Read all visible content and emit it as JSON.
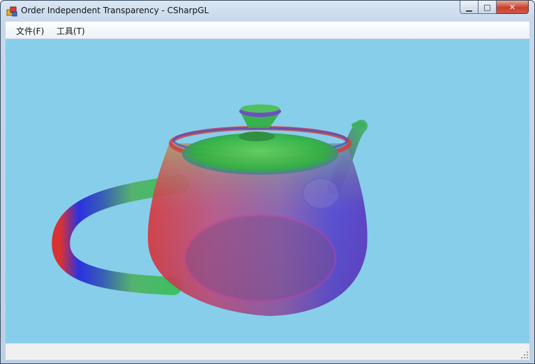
{
  "window": {
    "title": "Order Independent Transparency - CSharpGL",
    "controls": {
      "minimize_glyph": "▁",
      "maximize_glyph": "□",
      "close_glyph": "✕"
    }
  },
  "menu": {
    "items": [
      {
        "label": "文件(F)"
      },
      {
        "label": "工具(T)"
      }
    ]
  },
  "viewport": {
    "background_color": "#87ceea",
    "content": "teapot-icon"
  },
  "colors": {
    "red": "#e02020",
    "green": "#20c040",
    "blue": "#3030e0"
  }
}
